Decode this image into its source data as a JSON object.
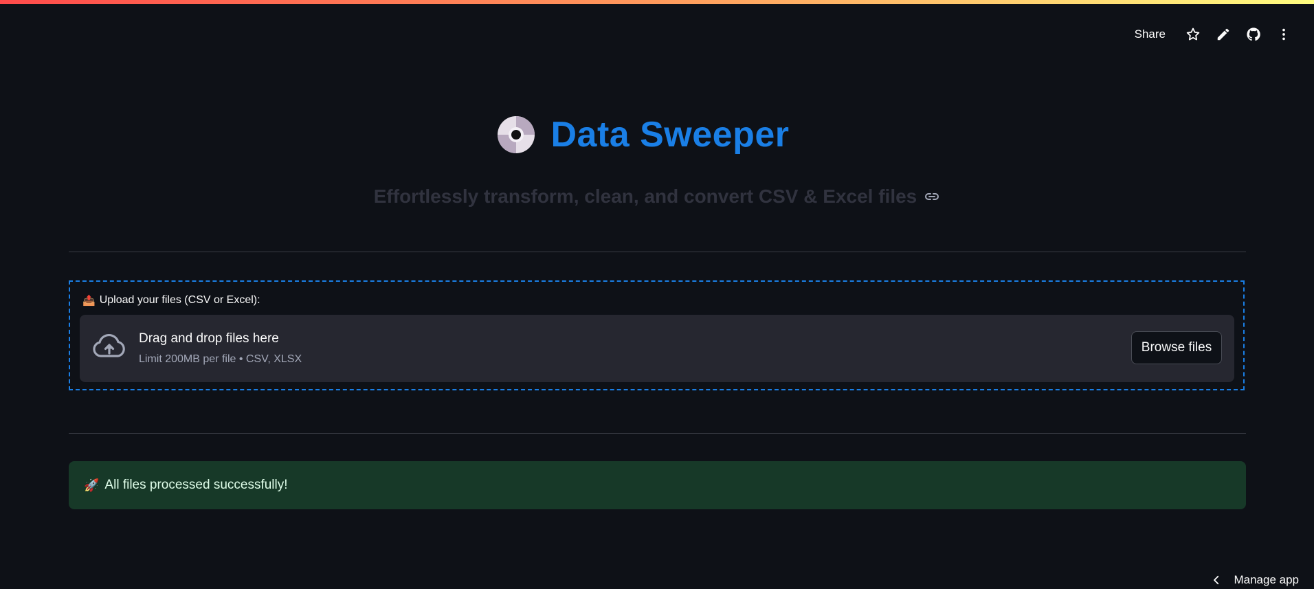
{
  "header": {
    "share_label": "Share",
    "icons": [
      "star-icon",
      "pencil-icon",
      "github-icon",
      "more-vertical-icon"
    ]
  },
  "app": {
    "title": "Data Sweeper",
    "title_icon": "disc-icon",
    "title_color": "#1a7fe6",
    "subtitle": "Effortlessly transform, clean, and convert CSV & Excel files"
  },
  "uploader": {
    "label_emoji": "📤",
    "label": "Upload your files (CSV or Excel):",
    "drop_title": "Drag and drop files here",
    "limit_text": "Limit 200MB per file • CSV, XLSX",
    "browse_label": "Browse files"
  },
  "status": {
    "emoji": "🚀",
    "message": "All files processed successfully!",
    "color": "#173928"
  },
  "footer": {
    "manage_label": "Manage app"
  }
}
